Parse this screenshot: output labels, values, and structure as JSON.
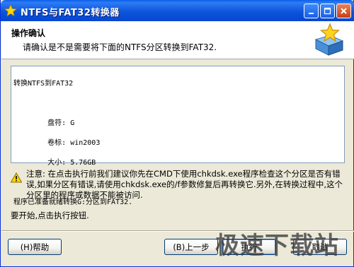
{
  "window": {
    "title": "NTFS与FAT32转换器"
  },
  "header": {
    "title": "操作确认",
    "subtitle": "请确认是不是需要将下面的NTFS分区转换到FAT32."
  },
  "details": {
    "line1": "转换NTFS到FAT32",
    "drive": "        盘符: G",
    "label": "        卷标: win2003",
    "size": "        大小: 5.76GB",
    "ready": "程序已准备就绪转换G:分区到FAT32."
  },
  "warning": {
    "text": "注意: 在点击执行前我们建议你先在CMD下使用chkdsk.exe程序检查这个分区是否有错误,如果分区有错误,请使用chkdsk.exe的/f参数修复后再转换它.另外,在转换过程中,这个分区里的程序或数据不能被访问."
  },
  "instruction": "要开始,点击执行按钮.",
  "buttons": {
    "help": "(H)帮助",
    "back": "(B)上一步",
    "execute": "执行",
    "cancel": "取消"
  },
  "watermark": "极速下载站",
  "colors": {
    "titlebar": "#0A5FE8",
    "dialog_bg": "#ECE9D8",
    "close_button": "#C83E12"
  }
}
